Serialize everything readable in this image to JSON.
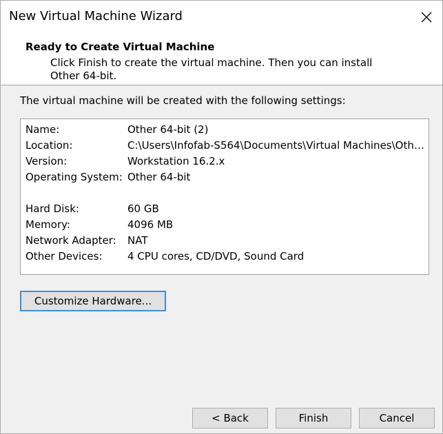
{
  "window": {
    "title": "New Virtual Machine Wizard"
  },
  "header": {
    "title": "Ready to Create Virtual Machine",
    "description": "Click Finish to create the virtual machine. Then you can install Other 64-bit."
  },
  "intro": "The virtual machine will be created with the following settings:",
  "settings": [
    {
      "label": "Name:",
      "value": "Other 64-bit (2)"
    },
    {
      "label": "Location:",
      "value": "C:\\Users\\Infofab-S564\\Documents\\Virtual Machines\\Other ..."
    },
    {
      "label": "Version:",
      "value": "Workstation 16.2.x"
    },
    {
      "label": "Operating System:",
      "value": "Other 64-bit"
    },
    {
      "label": "Hard Disk:",
      "value": "60 GB"
    },
    {
      "label": "Memory:",
      "value": "4096 MB"
    },
    {
      "label": "Network Adapter:",
      "value": "NAT"
    },
    {
      "label": "Other Devices:",
      "value": "4 CPU cores, CD/DVD, Sound Card"
    }
  ],
  "buttons": {
    "customize": "Customize Hardware...",
    "back": "< Back",
    "finish": "Finish",
    "cancel": "Cancel"
  },
  "icons": {
    "close": "close-icon"
  },
  "colors": {
    "focus_border": "#3c8fd9",
    "button_bg": "#e1e1e1",
    "window_bg": "#f0f0f0"
  }
}
